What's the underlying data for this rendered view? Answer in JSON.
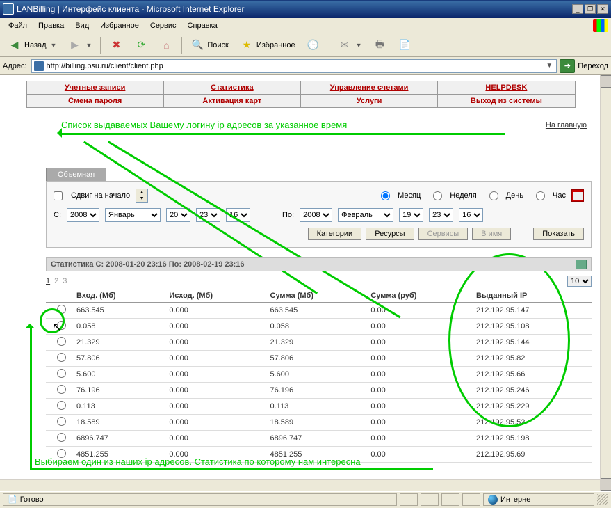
{
  "window": {
    "title": "LANBilling | Интерфейс клиента - Microsoft Internet Explorer"
  },
  "menu": {
    "items": [
      "Файл",
      "Правка",
      "Вид",
      "Избранное",
      "Сервис",
      "Справка"
    ]
  },
  "toolbar": {
    "back": "Назад",
    "search": "Поиск",
    "favorites": "Избранное"
  },
  "address": {
    "label": "Адрес:",
    "url": "http://billing.psu.ru/client/client.php",
    "go": "Переход"
  },
  "nav": {
    "row1": [
      "Учетные записи",
      "Статистика",
      "Управление счетами",
      "HELPDESK"
    ],
    "row2": [
      "Смена пароля",
      "Активация карт",
      "Услуги",
      "Выход из системы"
    ]
  },
  "annot": {
    "top": "Список выдаваемых Вашему логину ip адресов за указанное время",
    "bottom": "Выбираем один из наших ip адресов. Статистика по которому нам интересна"
  },
  "mainlink": "На главную",
  "tab": "Объемная",
  "filter": {
    "shift": "Сдвиг на начало",
    "period": {
      "month": "Месяц",
      "week": "Неделя",
      "day": "День",
      "hour": "Час"
    },
    "from_label": "С:",
    "to_label": "По:",
    "from": {
      "year": "2008",
      "month": "Январь",
      "day": "20",
      "hour": "23",
      "min": "16"
    },
    "to": {
      "year": "2008",
      "month": "Февраль",
      "day": "19",
      "hour": "23",
      "min": "16"
    },
    "buttons": {
      "cat": "Категории",
      "res": "Ресурсы",
      "serv": "Сервисы",
      "name": "В имя",
      "show": "Показать"
    }
  },
  "stats_header": "Статистика С: 2008-01-20 23:16 По: 2008-02-19 23:16",
  "pager": {
    "pages": [
      "1",
      "2",
      "3"
    ],
    "perpage": "10"
  },
  "table": {
    "headers": [
      "Вход. (Мб)",
      "Исход. (Мб)",
      "Сумма (Мб)",
      "Сумма (руб)",
      "Выданный IP"
    ],
    "rows": [
      {
        "in": "663.545",
        "out": "0.000",
        "sum": "663.545",
        "rub": "0.00",
        "ip": "212.192.95.147"
      },
      {
        "in": "0.058",
        "out": "0.000",
        "sum": "0.058",
        "rub": "0.00",
        "ip": "212.192.95.108"
      },
      {
        "in": "21.329",
        "out": "0.000",
        "sum": "21.329",
        "rub": "0.00",
        "ip": "212.192.95.144"
      },
      {
        "in": "57.806",
        "out": "0.000",
        "sum": "57.806",
        "rub": "0.00",
        "ip": "212.192.95.82"
      },
      {
        "in": "5.600",
        "out": "0.000",
        "sum": "5.600",
        "rub": "0.00",
        "ip": "212.192.95.66"
      },
      {
        "in": "76.196",
        "out": "0.000",
        "sum": "76.196",
        "rub": "0.00",
        "ip": "212.192.95.246"
      },
      {
        "in": "0.113",
        "out": "0.000",
        "sum": "0.113",
        "rub": "0.00",
        "ip": "212.192.95.229"
      },
      {
        "in": "18.589",
        "out": "0.000",
        "sum": "18.589",
        "rub": "0.00",
        "ip": "212.192.95.52"
      },
      {
        "in": "6896.747",
        "out": "0.000",
        "sum": "6896.747",
        "rub": "0.00",
        "ip": "212.192.95.198"
      },
      {
        "in": "4851.255",
        "out": "0.000",
        "sum": "4851.255",
        "rub": "0.00",
        "ip": "212.192.95.69"
      }
    ]
  },
  "status": {
    "ready": "Готово",
    "zone": "Интернет"
  }
}
